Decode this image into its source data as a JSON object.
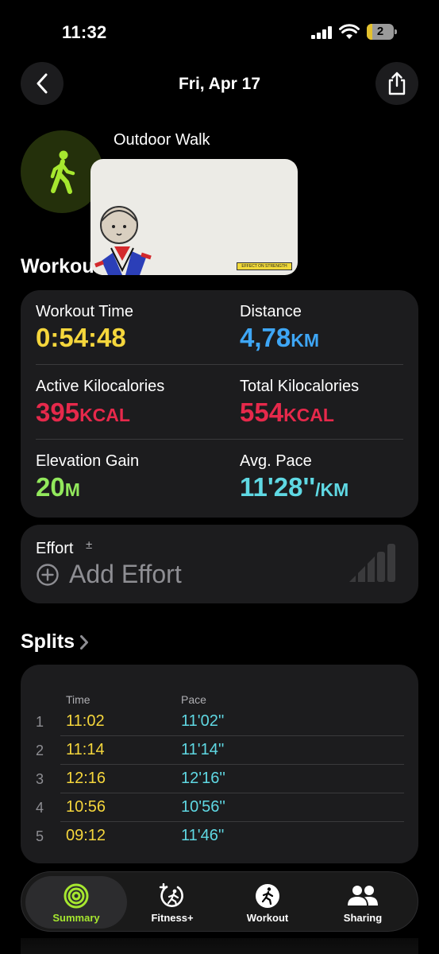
{
  "status_bar": {
    "time": "11:32",
    "battery": "2",
    "battery_level": 0.2
  },
  "header": {
    "title": "Fri, Apr 17"
  },
  "workout_type": {
    "name": "Outdoor Walk",
    "accent": "#a6e72f"
  },
  "overlay": {
    "stamp_text": "EFFECT ON STRENGTH"
  },
  "sections": {
    "workout": "Workout",
    "splits": "Splits"
  },
  "metrics": [
    {
      "label": "Workout Time",
      "value": "0:54:48",
      "unit": "",
      "color": "#f5d63c"
    },
    {
      "label": "Distance",
      "value": "4,78",
      "unit": "KM",
      "color": "#3ea6f5"
    },
    {
      "label": "Active Kilocalories",
      "value": "395",
      "unit": "KCAL",
      "color": "#e6294b"
    },
    {
      "label": "Total Kilocalories",
      "value": "554",
      "unit": "KCAL",
      "color": "#e6294b"
    },
    {
      "label": "Elevation Gain",
      "value": "20",
      "unit": "M",
      "color": "#92e85c"
    },
    {
      "label": "Avg. Pace",
      "value": "11'28''",
      "unit": "/KM",
      "color": "#5fd8e3"
    }
  ],
  "effort": {
    "label": "Effort",
    "symbol": "±",
    "action": "Add Effort"
  },
  "splits": {
    "time_header": "Time",
    "pace_header": "Pace",
    "rows": [
      {
        "n": "1",
        "time": "11:02",
        "pace": "11'02''"
      },
      {
        "n": "2",
        "time": "11:14",
        "pace": "11'14''"
      },
      {
        "n": "3",
        "time": "12:16",
        "pace": "12'16''"
      },
      {
        "n": "4",
        "time": "10:56",
        "pace": "10'56''"
      },
      {
        "n": "5",
        "time": "09:12",
        "pace": "11'46''"
      }
    ]
  },
  "tabs": [
    {
      "label": "Summary",
      "icon": "activity-rings-icon",
      "active": true
    },
    {
      "label": "Fitness+",
      "icon": "fitness-plus-icon",
      "active": false
    },
    {
      "label": "Workout",
      "icon": "running-figure-icon",
      "active": false
    },
    {
      "label": "Sharing",
      "icon": "people-icon",
      "active": false
    }
  ]
}
